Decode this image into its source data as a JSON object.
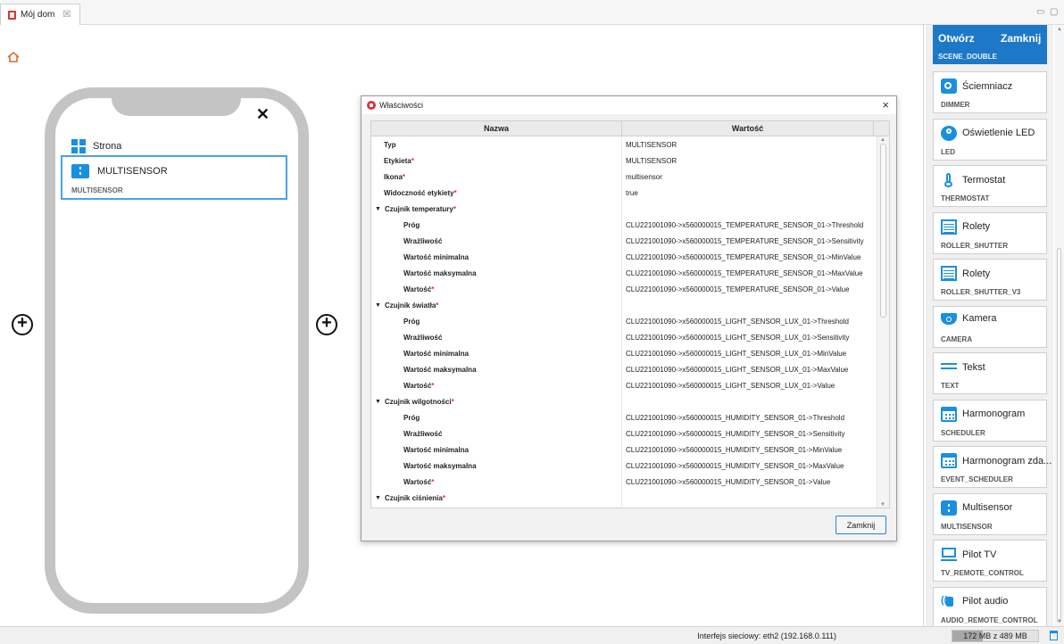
{
  "tab": {
    "title": "Mój dom",
    "close": "☒"
  },
  "window_controls": {
    "minimize": "▭",
    "maximize": "▢"
  },
  "canvas": {
    "page_label": "Strona",
    "close_glyph": "✕",
    "widget": {
      "label": "MULTISENSOR",
      "type": "MULTISENSOR"
    },
    "add_glyph": "+"
  },
  "dialog": {
    "title": "Właściwości",
    "close": "×",
    "columns": {
      "name": "Nazwa",
      "value": "Wartość"
    },
    "rows": [
      {
        "name": "Typ",
        "value": "MULTISENSOR",
        "required": false,
        "kind": "top"
      },
      {
        "name": "Etykieta",
        "value": "MULTISENSOR",
        "required": true,
        "kind": "top"
      },
      {
        "name": "Ikona",
        "value": "multisensor",
        "required": true,
        "kind": "top"
      },
      {
        "name": "Widoczność etykiety",
        "value": "true",
        "required": true,
        "kind": "top"
      },
      {
        "name": "Czujnik temperatury",
        "value": "",
        "required": true,
        "kind": "group"
      },
      {
        "name": "Próg",
        "value": "CLU221001090->x560000015_TEMPERATURE_SENSOR_01->Threshold",
        "required": false,
        "kind": "child"
      },
      {
        "name": "Wrażliwość",
        "value": "CLU221001090->x560000015_TEMPERATURE_SENSOR_01->Sensitivity",
        "required": false,
        "kind": "child"
      },
      {
        "name": "Wartość minimalna",
        "value": "CLU221001090->x560000015_TEMPERATURE_SENSOR_01->MinValue",
        "required": false,
        "kind": "child"
      },
      {
        "name": "Wartość maksymalna",
        "value": "CLU221001090->x560000015_TEMPERATURE_SENSOR_01->MaxValue",
        "required": false,
        "kind": "child"
      },
      {
        "name": "Wartość",
        "value": "CLU221001090->x560000015_TEMPERATURE_SENSOR_01->Value",
        "required": true,
        "kind": "child"
      },
      {
        "name": "Czujnik światła",
        "value": "",
        "required": true,
        "kind": "group"
      },
      {
        "name": "Próg",
        "value": "CLU221001090->x560000015_LIGHT_SENSOR_LUX_01->Threshold",
        "required": false,
        "kind": "child"
      },
      {
        "name": "Wrażliwość",
        "value": "CLU221001090->x560000015_LIGHT_SENSOR_LUX_01->Sensitivity",
        "required": false,
        "kind": "child"
      },
      {
        "name": "Wartość minimalna",
        "value": "CLU221001090->x560000015_LIGHT_SENSOR_LUX_01->MinValue",
        "required": false,
        "kind": "child"
      },
      {
        "name": "Wartość maksymalna",
        "value": "CLU221001090->x560000015_LIGHT_SENSOR_LUX_01->MaxValue",
        "required": false,
        "kind": "child"
      },
      {
        "name": "Wartość",
        "value": "CLU221001090->x560000015_LIGHT_SENSOR_LUX_01->Value",
        "required": true,
        "kind": "child"
      },
      {
        "name": "Czujnik wilgotności",
        "value": "",
        "required": true,
        "kind": "group"
      },
      {
        "name": "Próg",
        "value": "CLU221001090->x560000015_HUMIDITY_SENSOR_01->Threshold",
        "required": false,
        "kind": "child"
      },
      {
        "name": "Wrażliwość",
        "value": "CLU221001090->x560000015_HUMIDITY_SENSOR_01->Sensitivity",
        "required": false,
        "kind": "child"
      },
      {
        "name": "Wartość minimalna",
        "value": "CLU221001090->x560000015_HUMIDITY_SENSOR_01->MinValue",
        "required": false,
        "kind": "child"
      },
      {
        "name": "Wartość maksymalna",
        "value": "CLU221001090->x560000015_HUMIDITY_SENSOR_01->MaxValue",
        "required": false,
        "kind": "child"
      },
      {
        "name": "Wartość",
        "value": "CLU221001090->x560000015_HUMIDITY_SENSOR_01->Value",
        "required": true,
        "kind": "child"
      },
      {
        "name": "Czujnik ciśnienia",
        "value": "",
        "required": true,
        "kind": "group"
      }
    ],
    "close_button": "Zamknij"
  },
  "palette": {
    "scene": {
      "open": "Otwórz",
      "close": "Zamknij",
      "type": "SCENE_DOUBLE"
    },
    "items": [
      {
        "label": "Ściemniacz",
        "type": "DIMMER",
        "icon": "dimmer-icon"
      },
      {
        "label": "Oświetlenie LED",
        "type": "LED",
        "icon": "led-icon"
      },
      {
        "label": "Termostat",
        "type": "THERMOSTAT",
        "icon": "thermostat-icon"
      },
      {
        "label": "Rolety",
        "type": "ROLLER_SHUTTER",
        "icon": "roller-shutter-icon"
      },
      {
        "label": "Rolety",
        "type": "ROLLER_SHUTTER_V3",
        "icon": "roller-shutter-icon"
      },
      {
        "label": "Kamera",
        "type": "CAMERA",
        "icon": "camera-icon"
      },
      {
        "label": "Tekst",
        "type": "TEXT",
        "icon": "text-icon"
      },
      {
        "label": "Harmonogram",
        "type": "SCHEDULER",
        "icon": "calendar-icon"
      },
      {
        "label": "Harmonogram zda...",
        "type": "EVENT_SCHEDULER",
        "icon": "calendar-icon"
      },
      {
        "label": "Multisensor",
        "type": "MULTISENSOR",
        "icon": "multisensor-icon"
      },
      {
        "label": "Pilot TV",
        "type": "TV_REMOTE_CONTROL",
        "icon": "tv-remote-icon"
      },
      {
        "label": "Pilot audio",
        "type": "AUDIO_REMOTE_CONTROL",
        "icon": "audio-remote-icon"
      }
    ]
  },
  "status": {
    "network": "Interfejs sieciowy: eth2 (192.168.0.111)",
    "memory": "172 MB z 489 MB",
    "memory_fraction": 0.35
  },
  "colors": {
    "accent": "#1a8fe0",
    "required": "#d33333",
    "scene": "#1d78c8"
  }
}
